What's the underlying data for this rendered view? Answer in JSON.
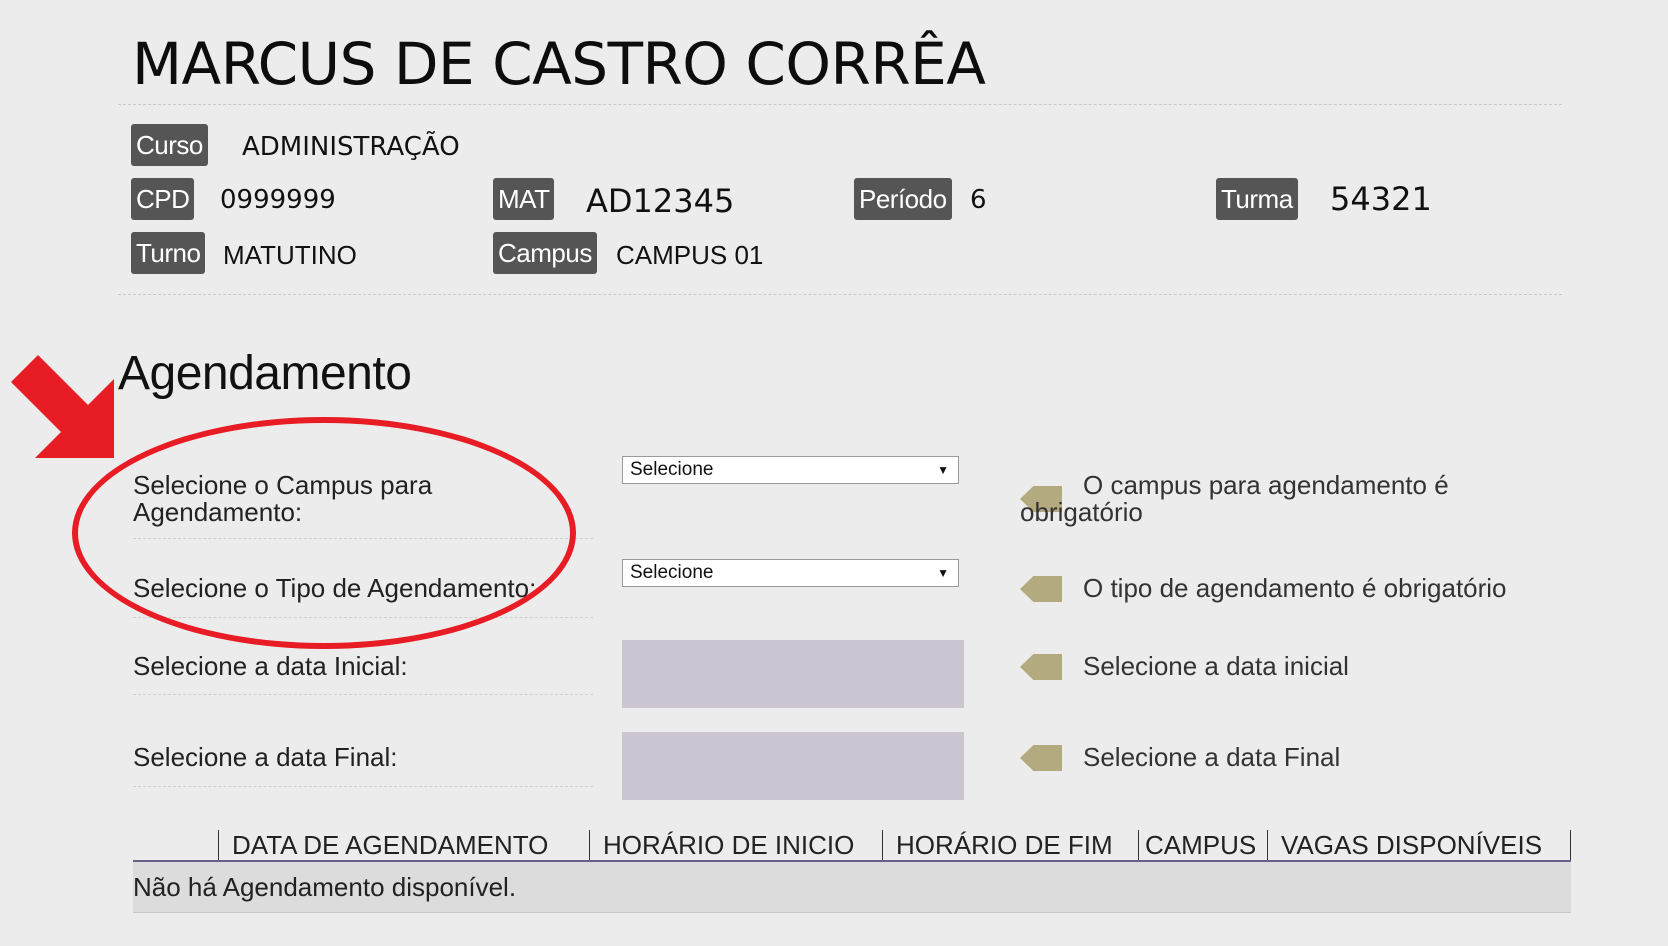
{
  "student": {
    "name": "MARCUS DE CASTRO CORRÊA"
  },
  "info": {
    "curso_label": "Curso",
    "curso_value": "ADMINISTRAÇÃO",
    "cpd_label": "CPD",
    "cpd_value": "0999999",
    "mat_label": "MAT",
    "mat_value": "AD12345",
    "periodo_label": "Período",
    "periodo_value": "6",
    "turma_label": "Turma",
    "turma_value": "54321",
    "turno_label": "Turno",
    "turno_value": "MATUTINO",
    "campus_label": "Campus",
    "campus_value": "CAMPUS 01"
  },
  "agendamento": {
    "title": "Agendamento",
    "campus_label_line1": "Selecione o Campus para",
    "campus_label_line2": "Agendamento:",
    "campus_select_value": "Selecione",
    "campus_msg_line1": "O campus para agendamento é",
    "campus_msg_line2": "obrigatório",
    "tipo_label": "Selecione o Tipo de Agendamento:",
    "tipo_select_value": "Selecione",
    "tipo_msg": "O tipo de agendamento é obrigatório",
    "data_inicial_label": "Selecione a data Inicial:",
    "data_inicial_msg": "Selecione a data inicial",
    "data_final_label": "Selecione a data Final:",
    "data_final_msg": "Selecione a data Final"
  },
  "table": {
    "columns": [
      "DATA DE AGENDAMENTO",
      "HORÁRIO DE INICIO",
      "HORÁRIO DE FIM",
      "CAMPUS",
      "VAGAS DISPONÍVEIS"
    ],
    "empty_message": "Não há Agendamento disponível."
  },
  "annotation": {
    "color": "#e81c24"
  },
  "colors": {
    "badge": "#555555",
    "date_field": "#cac5d1",
    "tag_icon": "#b3aa7f",
    "table_rule": "#6a5e8a"
  }
}
